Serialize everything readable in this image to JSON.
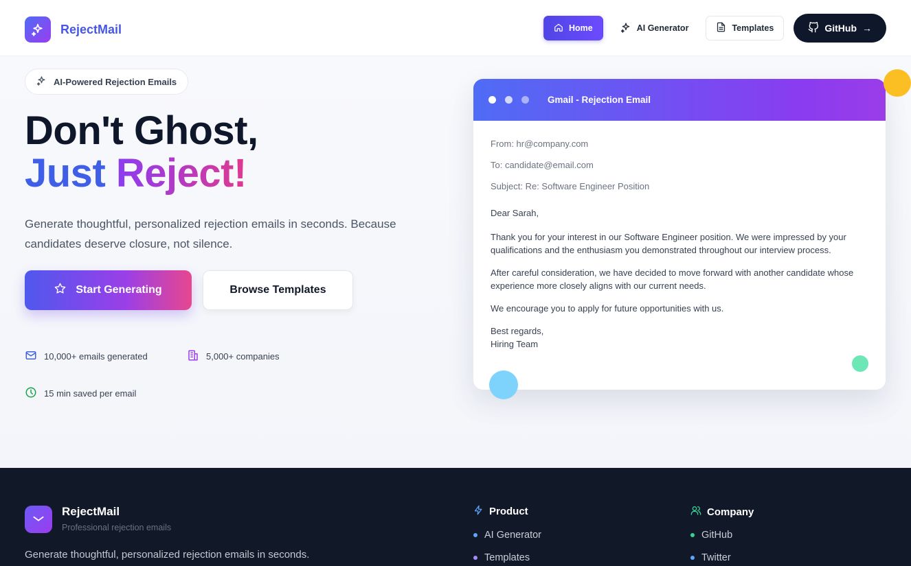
{
  "header": {
    "brand": "RejectMail",
    "nav": {
      "home": "Home",
      "ai_generator": "AI Generator",
      "templates": "Templates",
      "github": "GitHub"
    }
  },
  "hero": {
    "badge": "AI-Powered Rejection Emails",
    "headline_line1": "Don't Ghost,",
    "headline_just": "Just",
    "headline_reject": "Reject!",
    "subtext": "Generate thoughtful, personalized rejection emails in seconds. Because candidates deserve closure, not silence.",
    "cta_primary": "Start Generating",
    "cta_secondary": "Browse Templates",
    "stats": [
      "10,000+ emails generated",
      "5,000+ companies",
      "15 min saved per email"
    ]
  },
  "email_preview": {
    "title": "Gmail - Rejection Email",
    "from": "From: hr@company.com",
    "to": "To: candidate@email.com",
    "subject": "Subject: Re: Software Engineer Position",
    "greeting": "Dear Sarah,",
    "p1": "Thank you for your interest in our Software Engineer position. We were impressed by your qualifications and the enthusiasm you demonstrated throughout our interview process.",
    "p2": "After careful consideration, we have decided to move forward with another candidate whose experience more closely aligns with our current needs.",
    "p3": "We encourage you to apply for future opportunities with us.",
    "signoff": "Best regards,",
    "signature": "Hiring Team"
  },
  "footer": {
    "brand": "RejectMail",
    "tagline": "Professional rejection emails",
    "description": "Generate thoughtful, personalized rejection emails in seconds.",
    "product": {
      "title": "Product",
      "links": [
        "AI Generator",
        "Templates"
      ]
    },
    "company": {
      "title": "Company",
      "links": [
        "GitHub",
        "Twitter"
      ]
    }
  },
  "colors": {
    "brand": "#4856e8",
    "accent_purple": "#8b3cf2",
    "accent_pink": "#e0398f",
    "footer_bg": "#111827"
  }
}
